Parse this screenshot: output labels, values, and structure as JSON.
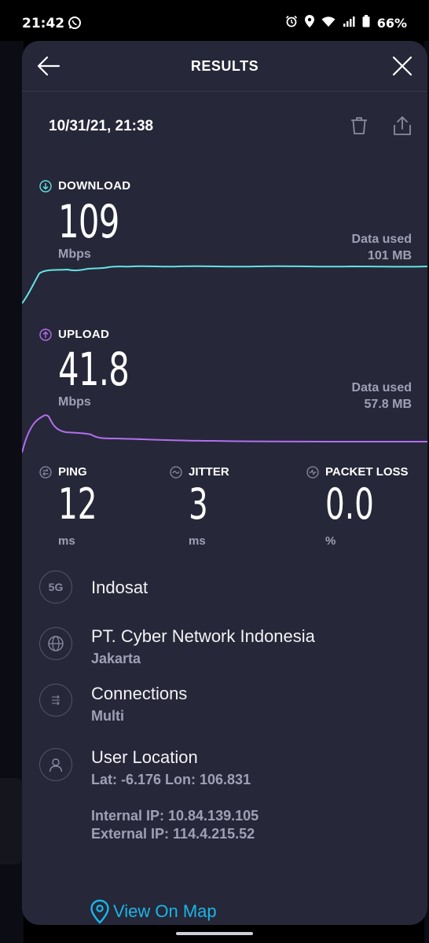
{
  "statusbar": {
    "time": "21:42",
    "battery": "66%"
  },
  "header": {
    "title": "RESULTS"
  },
  "result": {
    "date": "10/31/21, 21:38"
  },
  "download": {
    "label": "DOWNLOAD",
    "value": "109",
    "unit": "Mbps",
    "data_used_label": "Data used",
    "data_used_value": "101 MB"
  },
  "upload": {
    "label": "UPLOAD",
    "value": "41.8",
    "unit": "Mbps",
    "data_used_label": "Data used",
    "data_used_value": "57.8 MB"
  },
  "ping": {
    "label": "PING",
    "value": "12",
    "unit": "ms"
  },
  "jitter": {
    "label": "JITTER",
    "value": "3",
    "unit": "ms"
  },
  "packet_loss": {
    "label": "PACKET LOSS",
    "value": "0.0",
    "unit": "%"
  },
  "provider": {
    "badge": "5G",
    "name": "Indosat"
  },
  "server": {
    "name": "PT. Cyber Network Indonesia",
    "city": "Jakarta"
  },
  "connections": {
    "label": "Connections",
    "value": "Multi"
  },
  "location": {
    "label": "User Location",
    "coords": "Lat: -6.176 Lon: 106.831",
    "internal_ip": "Internal IP: 10.84.139.105",
    "external_ip": "External IP: 114.4.215.52"
  },
  "map": {
    "link": "View On Map"
  },
  "colors": {
    "background": "#262738",
    "download": "#63e3e3",
    "upload": "#b36ef0",
    "link": "#1bb5e6"
  }
}
